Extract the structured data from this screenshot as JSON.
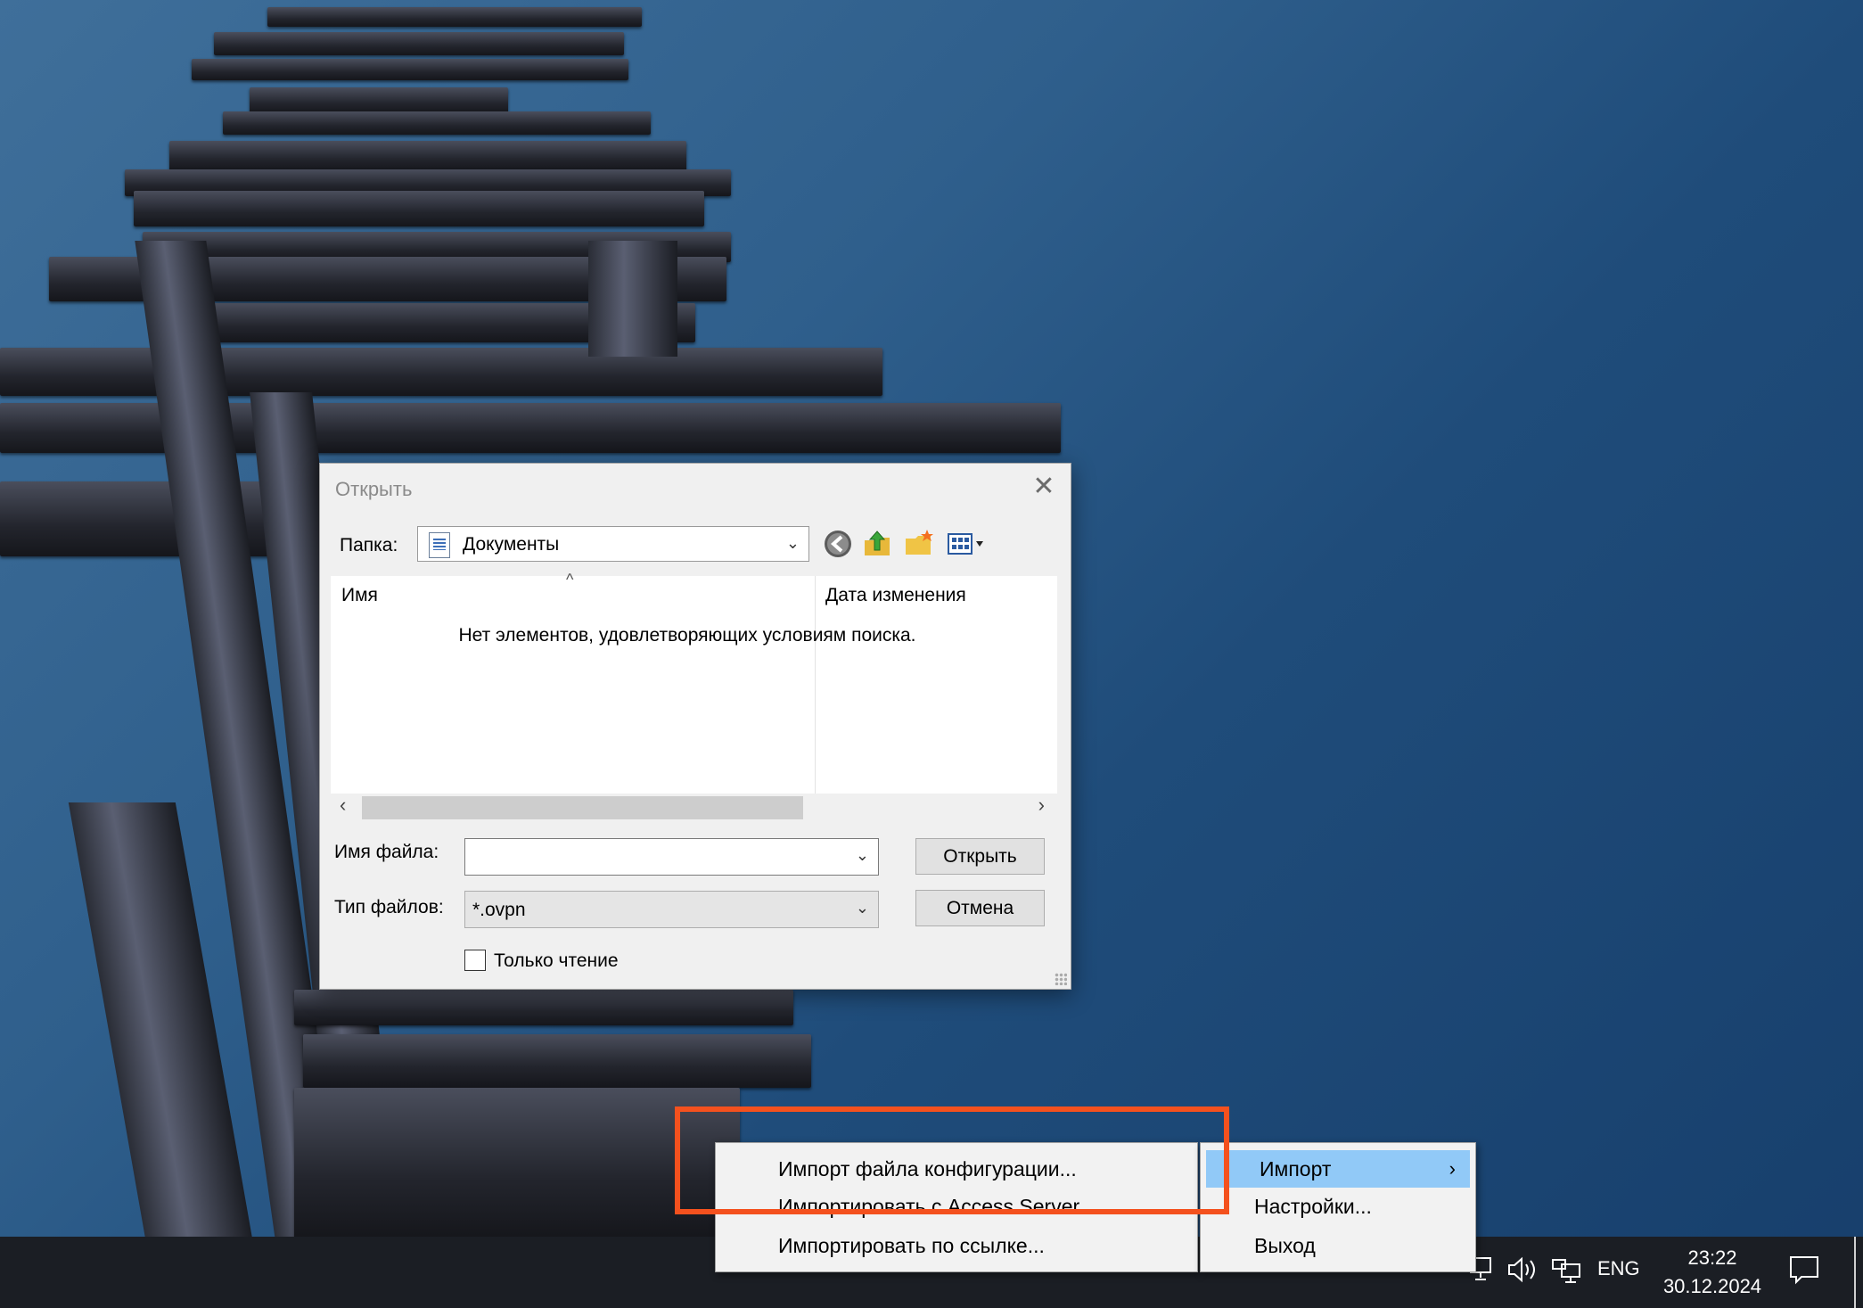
{
  "dialog": {
    "title": "Открыть",
    "folder_label": "Папка:",
    "folder_value": "Документы",
    "column_name": "Имя",
    "column_date": "Дата изменения",
    "empty_message": "Нет элементов, удовлетворяющих условиям поиска.",
    "filename_label": "Имя файла:",
    "filename_value": "",
    "filetype_label": "Тип файлов:",
    "filetype_value": "*.ovpn",
    "open_button": "Открыть",
    "cancel_button": "Отмена",
    "readonly_label": "Только чтение",
    "readonly_checked": false
  },
  "submenu": {
    "items": [
      {
        "label": "Импорт файла конфигурации..."
      },
      {
        "label": "Импортировать с Access Server..."
      },
      {
        "label": "Импортировать по ссылке..."
      }
    ]
  },
  "menu": {
    "items": [
      {
        "label": "Импорт",
        "has_submenu": true,
        "highlighted": true
      },
      {
        "label": "Настройки..."
      },
      {
        "label": "Выход"
      }
    ]
  },
  "taskbar": {
    "language": "ENG",
    "time": "23:22",
    "date": "30.12.2024"
  },
  "colors": {
    "highlight_box": "#f4511e",
    "menu_selection": "#91c9f7",
    "taskbar": "#1b1e24"
  }
}
